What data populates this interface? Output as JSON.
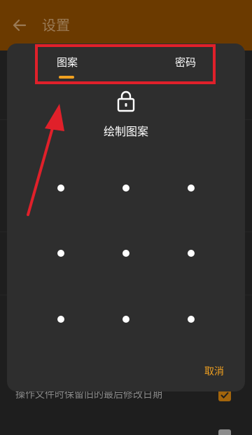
{
  "appbar": {
    "title": "设置",
    "back_icon": "arrow-left-icon",
    "color": "#6b3a00"
  },
  "background": {
    "setting_label": "操作文件时保留旧的最后修改日期",
    "setting_checked": true
  },
  "dialog": {
    "tabs": [
      {
        "label": "图案",
        "selected": true
      },
      {
        "label": "密码",
        "selected": false
      }
    ],
    "lock_icon": "lock-icon",
    "instruction": "绘制图案",
    "cancel_label": "取消",
    "accent_color": "#f0a020"
  },
  "annotation": {
    "color": "#e0202a"
  }
}
